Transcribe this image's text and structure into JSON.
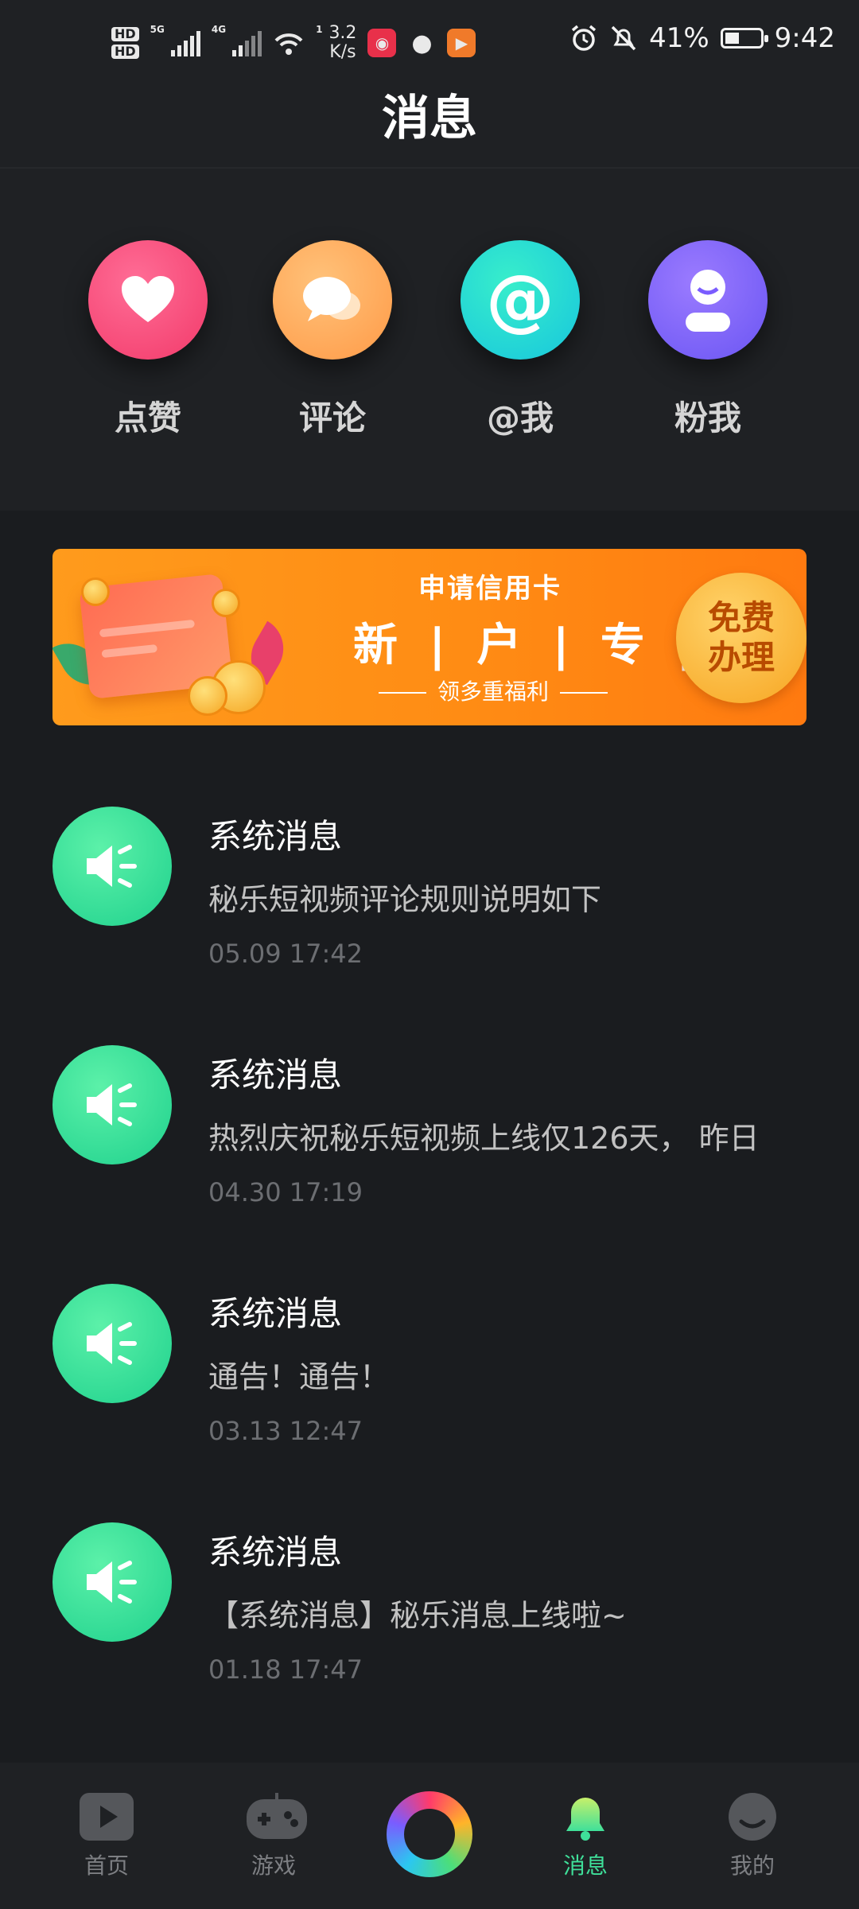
{
  "status_bar": {
    "net_label": "5G",
    "net_label2": "4G",
    "sim1": "HD",
    "sim2": "HD",
    "wifi_badge": "1",
    "speed": "3.2",
    "speed_unit": "K/s",
    "battery_percent": "41%",
    "battery_level": 0.41,
    "time": "9:42"
  },
  "header": {
    "title": "消息"
  },
  "quick_actions": [
    {
      "label": "点赞",
      "icon": "heart-icon"
    },
    {
      "label": "评论",
      "icon": "comment-icon"
    },
    {
      "label": "@我",
      "icon": "at-icon"
    },
    {
      "label": "粉我",
      "icon": "follower-icon"
    }
  ],
  "banner": {
    "subtitle": "申请信用卡",
    "headline": "新 | 户 | 专 | 享",
    "footer": "领多重福利",
    "button_line1": "免费",
    "button_line2": "办理"
  },
  "messages": [
    {
      "title": "系统消息",
      "body": "秘乐短视频评论规则说明如下",
      "time": "05.09 17:42",
      "icon": "speaker-icon"
    },
    {
      "title": "系统消息",
      "body": "热烈庆祝秘乐短视频上线仅126天， 昨日",
      "time": "04.30 17:19",
      "icon": "speaker-icon"
    },
    {
      "title": "系统消息",
      "body": "通告！通告！",
      "time": "03.13 12:47",
      "icon": "speaker-icon"
    },
    {
      "title": "系统消息",
      "body": "【系统消息】秘乐消息上线啦~",
      "time": "01.18 17:47",
      "icon": "speaker-icon"
    }
  ],
  "bottom_nav": {
    "items": [
      {
        "label": "首页",
        "icon": "video-play-icon"
      },
      {
        "label": "游戏",
        "icon": "gamepad-icon"
      },
      {
        "label": "",
        "icon": "create-ring-icon"
      },
      {
        "label": "消息",
        "icon": "bell-icon",
        "active": true
      },
      {
        "label": "我的",
        "icon": "profile-icon"
      }
    ]
  },
  "colors": {
    "accent": "#3fe09a",
    "background": "#1a1c1f",
    "banner": "#ff8c14"
  }
}
